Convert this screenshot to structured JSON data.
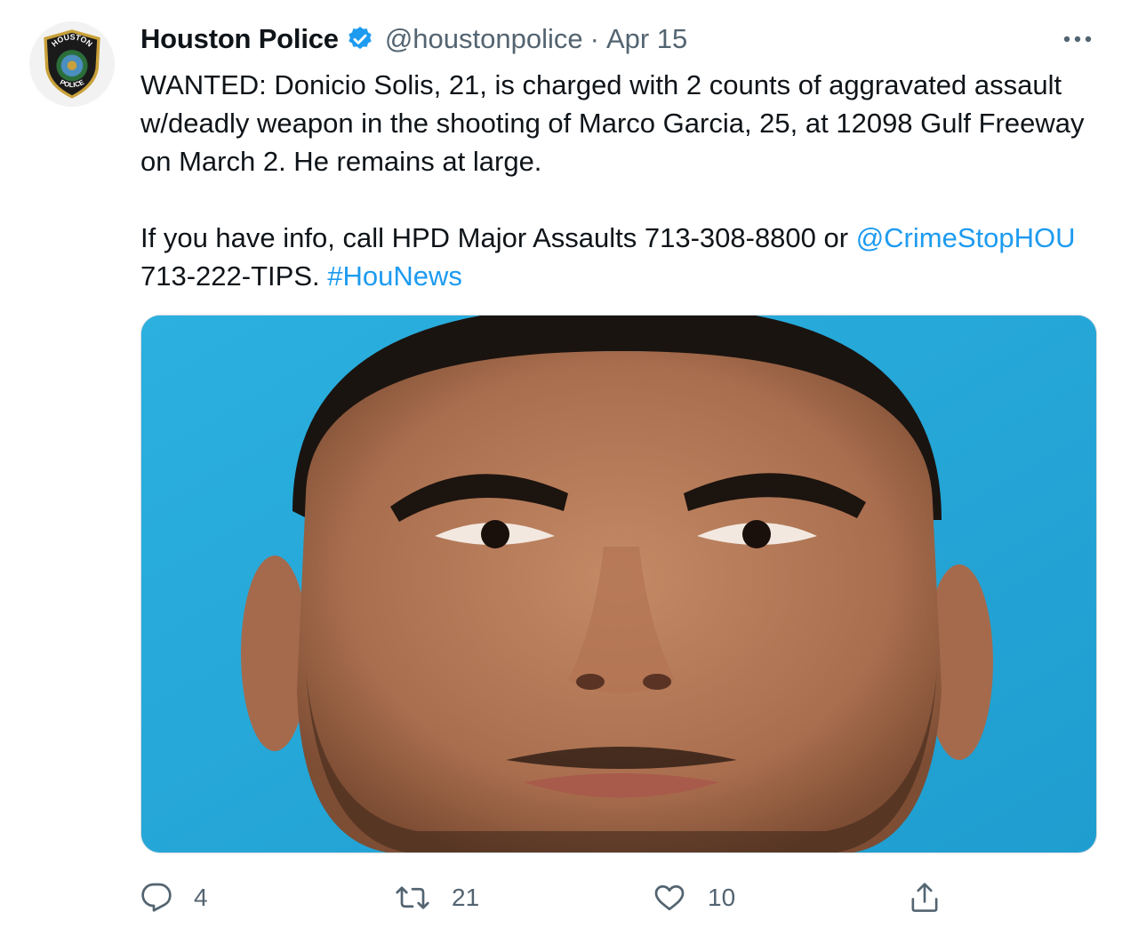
{
  "tweet": {
    "author": {
      "display_name": "Houston Police",
      "handle": "@houstonpolice",
      "verified": true,
      "avatar_icon": "houston-police-badge-icon"
    },
    "separator": "·",
    "date": "Apr 15",
    "text": {
      "paragraph1": "WANTED: Donicio Solis, 21, is charged with 2 counts of aggravated assault w/deadly weapon in the shooting of Marco Garcia, 25, at 12098 Gulf Freeway on March 2.  He remains at large.",
      "paragraph2_prefix": "If you have info, call HPD Major Assaults 713-308-8800 or ",
      "mention": "@CrimeStopHOU",
      "paragraph2_middle": " 713-222-TIPS.  ",
      "hashtag": "#HouNews"
    },
    "actions": {
      "reply_count": "4",
      "retweet_count": "21",
      "like_count": "10"
    }
  },
  "badge": {
    "top_text": "HOUSTON",
    "bottom_text": "POLICE"
  },
  "colors": {
    "link": "#1d9bf0",
    "secondary_text": "#536471",
    "photo_background": "#2aa6d6",
    "verified": "#1d9bf0"
  }
}
